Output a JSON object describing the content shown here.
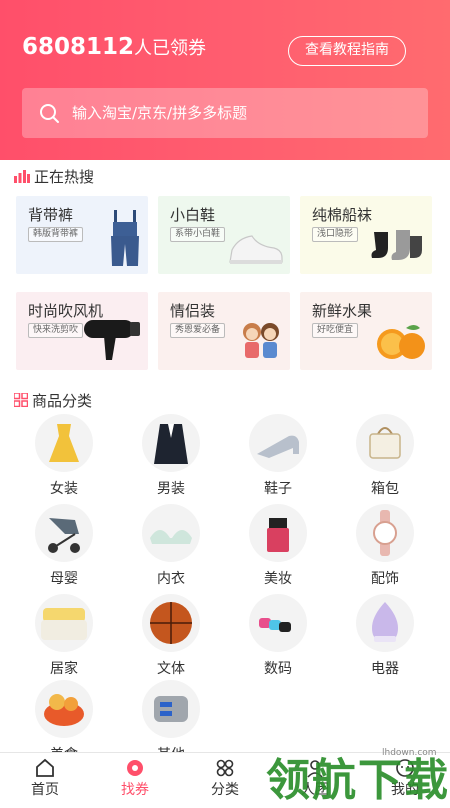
{
  "header": {
    "count_number": "6808112",
    "count_unit": "人已领券",
    "guide_button": "查看教程指南",
    "search_placeholder": "输入淘宝/京东/拼多多标题"
  },
  "hot_search": {
    "title": "正在热搜",
    "items": [
      {
        "title": "背带裤",
        "tag": "韩版背带裤",
        "icon": "overalls-icon",
        "bg": "#eef3fb"
      },
      {
        "title": "小白鞋",
        "tag": "系带小白鞋",
        "icon": "sneaker-icon",
        "bg": "#eef8ee"
      },
      {
        "title": "纯棉船袜",
        "tag": "浅口隐形",
        "icon": "socks-icon",
        "bg": "#fbfbe9"
      },
      {
        "title": "时尚吹风机",
        "tag": "快来洗剪吹",
        "icon": "hair-dryer-icon",
        "bg": "#fbeef1"
      },
      {
        "title": "情侣装",
        "tag": "秀恩爱必备",
        "icon": "couple-icon",
        "bg": "#fbf0ee"
      },
      {
        "title": "新鲜水果",
        "tag": "好吃便宜",
        "icon": "orange-icon",
        "bg": "#fbf1ee"
      }
    ]
  },
  "categories": {
    "title": "商品分类",
    "items": [
      {
        "label": "女装",
        "icon": "dress-icon"
      },
      {
        "label": "男装",
        "icon": "suit-icon"
      },
      {
        "label": "鞋子",
        "icon": "high-heel-icon"
      },
      {
        "label": "箱包",
        "icon": "handbag-icon"
      },
      {
        "label": "母婴",
        "icon": "stroller-icon"
      },
      {
        "label": "内衣",
        "icon": "bra-icon"
      },
      {
        "label": "美妆",
        "icon": "cosmetics-icon"
      },
      {
        "label": "配饰",
        "icon": "watch-icon"
      },
      {
        "label": "居家",
        "icon": "cushion-icon"
      },
      {
        "label": "文体",
        "icon": "basketball-icon"
      },
      {
        "label": "数码",
        "icon": "digital-icon"
      },
      {
        "label": "电器",
        "icon": "humidifier-icon"
      },
      {
        "label": "美食",
        "icon": "food-icon"
      },
      {
        "label": "其他",
        "icon": "car-charger-icon"
      }
    ]
  },
  "tabbar": {
    "items": [
      {
        "label": "首页",
        "icon": "home-icon"
      },
      {
        "label": "找券",
        "icon": "coupon-icon"
      },
      {
        "label": "分类",
        "icon": "category-icon"
      },
      {
        "label": "人团",
        "icon": "group-icon"
      },
      {
        "label": "我的",
        "icon": "profile-icon"
      }
    ],
    "active_color": "#ff4f6a"
  },
  "watermark": {
    "text": "领航下载",
    "site": "lhdown.com"
  }
}
